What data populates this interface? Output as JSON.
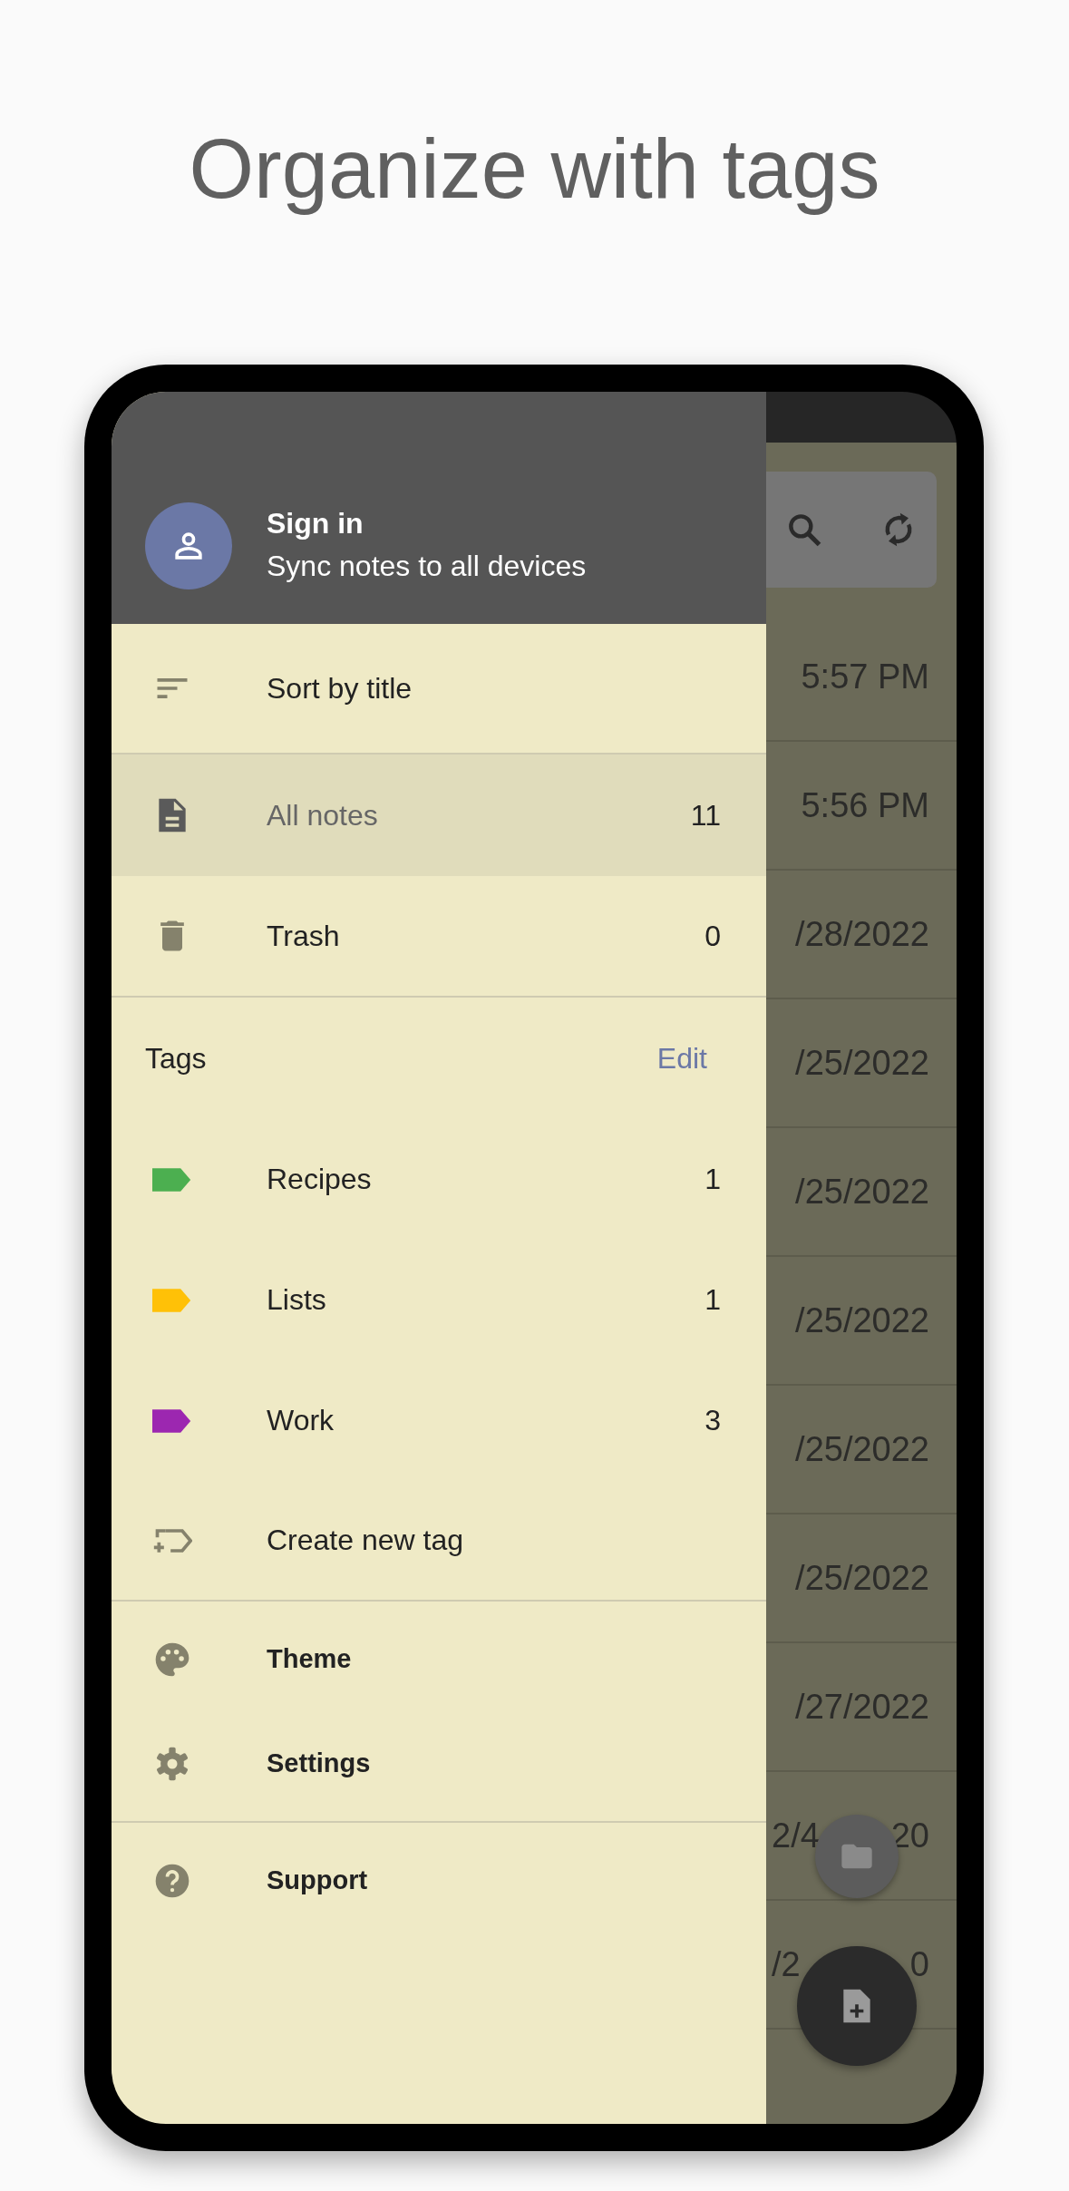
{
  "headline": "Organize with tags",
  "account": {
    "title": "Sign in",
    "subtitle": "Sync notes to all devices"
  },
  "sort": {
    "label": "Sort by title"
  },
  "nav": [
    {
      "kind": "notes",
      "label": "All notes",
      "count": "11",
      "selected": true
    },
    {
      "kind": "trash",
      "label": "Trash",
      "count": "0",
      "selected": false
    }
  ],
  "tags_header": {
    "title": "Tags",
    "action": "Edit"
  },
  "tags": [
    {
      "label": "Recipes",
      "count": "1",
      "color": "#4caf50"
    },
    {
      "label": "Lists",
      "count": "1",
      "color": "#ffc107"
    },
    {
      "label": "Work",
      "count": "3",
      "color": "#9c27b0"
    }
  ],
  "create_tag": {
    "label": "Create new tag"
  },
  "menu_groups": [
    [
      {
        "kind": "theme",
        "label": "Theme"
      },
      {
        "kind": "settings",
        "label": "Settings"
      }
    ],
    [
      {
        "kind": "support",
        "label": "Support"
      }
    ]
  ],
  "notes": [
    {
      "segments": [
        "5:57 PM"
      ]
    },
    {
      "segments": [
        "5:56 PM"
      ]
    },
    {
      "segments": [
        "/28/2022"
      ]
    },
    {
      "segments": [
        "/25/2022"
      ]
    },
    {
      "segments": [
        "/25/2022"
      ]
    },
    {
      "segments": [
        "/25/2022"
      ]
    },
    {
      "segments": [
        "/25/2022"
      ]
    },
    {
      "segments": [
        "/25/2022"
      ]
    },
    {
      "segments": [
        "/27/2022"
      ]
    },
    {
      "segments": [
        "2/4",
        "20"
      ]
    },
    {
      "segments": [
        "/2",
        "0"
      ]
    }
  ]
}
